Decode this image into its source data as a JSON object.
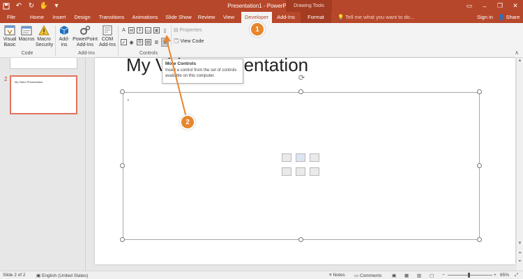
{
  "window": {
    "title": "Presentation1 - PowerPoint",
    "contextual_group": "Drawing Tools",
    "qat_icons": [
      "save-icon",
      "undo-icon",
      "redo-icon",
      "touch-mode-icon",
      "customize-icon"
    ],
    "buttons": [
      "ribbon-display-icon",
      "minimize-icon",
      "restore-icon",
      "close-icon"
    ]
  },
  "tabs": [
    {
      "label": "File"
    },
    {
      "label": "Home"
    },
    {
      "label": "Insert"
    },
    {
      "label": "Design"
    },
    {
      "label": "Transitions"
    },
    {
      "label": "Animations"
    },
    {
      "label": "Slide Show"
    },
    {
      "label": "Review"
    },
    {
      "label": "View"
    },
    {
      "label": "Developer"
    },
    {
      "label": "Add-Ins"
    },
    {
      "label": "Format"
    }
  ],
  "active_tab": "Developer",
  "tell_me": "Tell me what you want to do...",
  "sign_in": "Sign in",
  "share": "Share",
  "ribbon": {
    "code_group": {
      "label": "Code",
      "visual_basic": "Visual Basic",
      "macros": "Macros",
      "macro_security": "Macro Security"
    },
    "addins_group": {
      "label": "Add-Ins",
      "add_ins": "Add-ins",
      "powerpoint_addins": "PowerPoint Add-Ins",
      "com_addins": "COM Add-Ins"
    },
    "controls_group": {
      "label": "Controls",
      "properties": "Properties",
      "view_code": "View Code",
      "row1_icons": [
        "label-control-icon",
        "textbox-control-icon",
        "spin-button-icon",
        "command-button-icon",
        "image-control-icon"
      ],
      "row2_icons": [
        "checkbox-control-icon",
        "option-button-icon",
        "listbox-control-icon",
        "combobox-control-icon",
        "more-controls-icon"
      ]
    }
  },
  "tooltip": {
    "title": "More Controls",
    "description": "Insert a control from the set of controls available on this computer."
  },
  "slides": {
    "thumb2_number": "2",
    "thumb2_title": "My Video Presentation"
  },
  "slide": {
    "title": "My Video Presentation"
  },
  "callouts": [
    "1",
    "2"
  ],
  "status": {
    "slide_info": "Slide 2 of 2",
    "language": "English (United States)",
    "notes": "Notes",
    "comments": "Comments",
    "zoom": "85%"
  },
  "colors": {
    "accent": "#b7472a",
    "callout": "#e8862d",
    "selected_thumb": "#e1735b"
  }
}
